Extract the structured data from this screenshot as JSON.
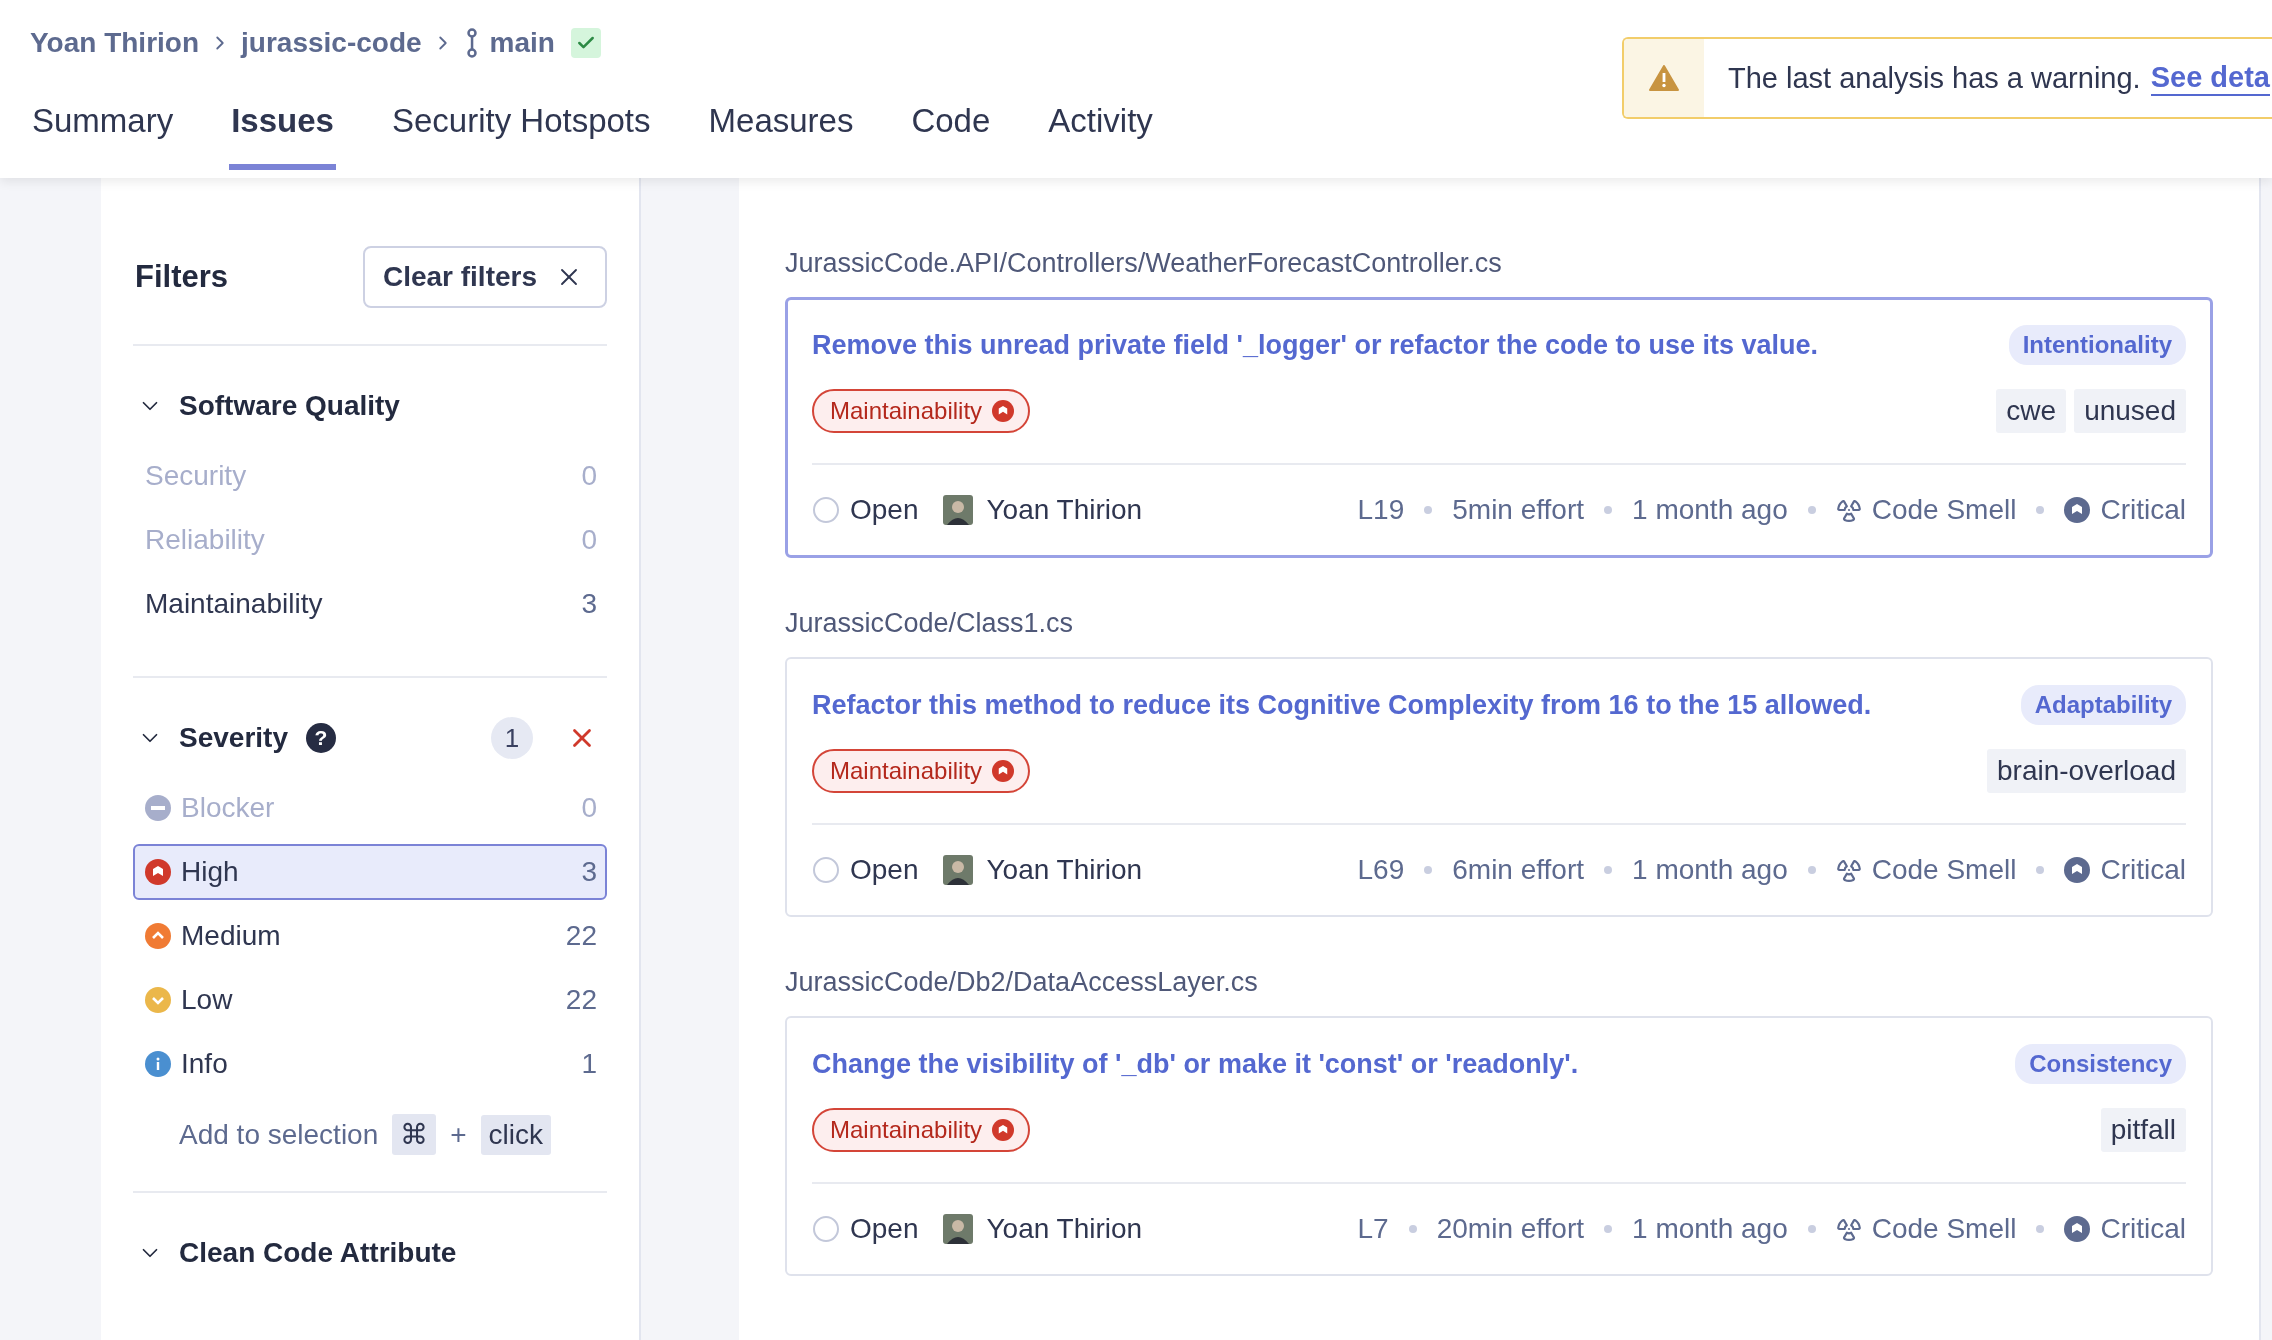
{
  "breadcrumb": {
    "items": [
      "Yoan Thirion",
      "jurassic-code"
    ],
    "branch": "main",
    "branch_ok": true
  },
  "tabs": [
    {
      "label": "Summary",
      "selected": false
    },
    {
      "label": "Issues",
      "selected": true
    },
    {
      "label": "Security Hotspots",
      "selected": false
    },
    {
      "label": "Measures",
      "selected": false
    },
    {
      "label": "Code",
      "selected": false
    },
    {
      "label": "Activity",
      "selected": false
    }
  ],
  "warning": {
    "text": "The last analysis has a warning.",
    "link": "See deta"
  },
  "filters": {
    "title": "Filters",
    "clear": "Clear filters",
    "sections": [
      {
        "title": "Software Quality",
        "expanded": true,
        "items": [
          {
            "label": "Security",
            "count": "0",
            "disabled": true,
            "selected": false
          },
          {
            "label": "Reliability",
            "count": "0",
            "disabled": true,
            "selected": false
          },
          {
            "label": "Maintainability",
            "count": "3",
            "disabled": false,
            "selected": false
          }
        ]
      },
      {
        "title": "Severity",
        "expanded": true,
        "help": "?",
        "badge": "1",
        "items": [
          {
            "label": "Blocker",
            "count": "0",
            "kind": "blocker",
            "disabled": true,
            "selected": false
          },
          {
            "label": "High",
            "count": "3",
            "kind": "high",
            "disabled": false,
            "selected": true
          },
          {
            "label": "Medium",
            "count": "22",
            "kind": "medium",
            "disabled": false,
            "selected": false
          },
          {
            "label": "Low",
            "count": "22",
            "kind": "low",
            "disabled": false,
            "selected": false
          },
          {
            "label": "Info",
            "count": "1",
            "kind": "info",
            "disabled": false,
            "selected": false
          }
        ],
        "hint": {
          "text": "Add to selection",
          "key": "⌘",
          "plus": "+",
          "click": "click"
        }
      },
      {
        "title": "Clean Code Attribute",
        "expanded": true
      }
    ]
  },
  "groups": [
    {
      "file": "JurassicCode.API/Controllers/WeatherForecastController.cs",
      "issues": [
        {
          "title": "Remove this unread private field '_logger' or refactor the code to use its value.",
          "attribute": "Intentionality",
          "quality": "Maintainability",
          "tags": [
            "cwe",
            "unused"
          ],
          "status": "Open",
          "assignee": "Yoan Thirion",
          "line": "L19",
          "effort": "5min effort",
          "age": "1 month ago",
          "type": "Code Smell",
          "severity": "Critical",
          "selected": true
        }
      ]
    },
    {
      "file": "JurassicCode/Class1.cs",
      "issues": [
        {
          "title": "Refactor this method to reduce its Cognitive Complexity from 16 to the 15 allowed.",
          "attribute": "Adaptability",
          "quality": "Maintainability",
          "tags": [
            "brain-overload"
          ],
          "status": "Open",
          "assignee": "Yoan Thirion",
          "line": "L69",
          "effort": "6min effort",
          "age": "1 month ago",
          "type": "Code Smell",
          "severity": "Critical",
          "selected": false
        }
      ]
    },
    {
      "file": "JurassicCode/Db2/DataAccessLayer.cs",
      "issues": [
        {
          "title": "Change the visibility of '_db' or make it 'const' or 'readonly'.",
          "attribute": "Consistency",
          "quality": "Maintainability",
          "tags": [
            "pitfall"
          ],
          "status": "Open",
          "assignee": "Yoan Thirion",
          "line": "L7",
          "effort": "20min effort",
          "age": "1 month ago",
          "type": "Code Smell",
          "severity": "Critical",
          "selected": false
        }
      ]
    }
  ]
}
